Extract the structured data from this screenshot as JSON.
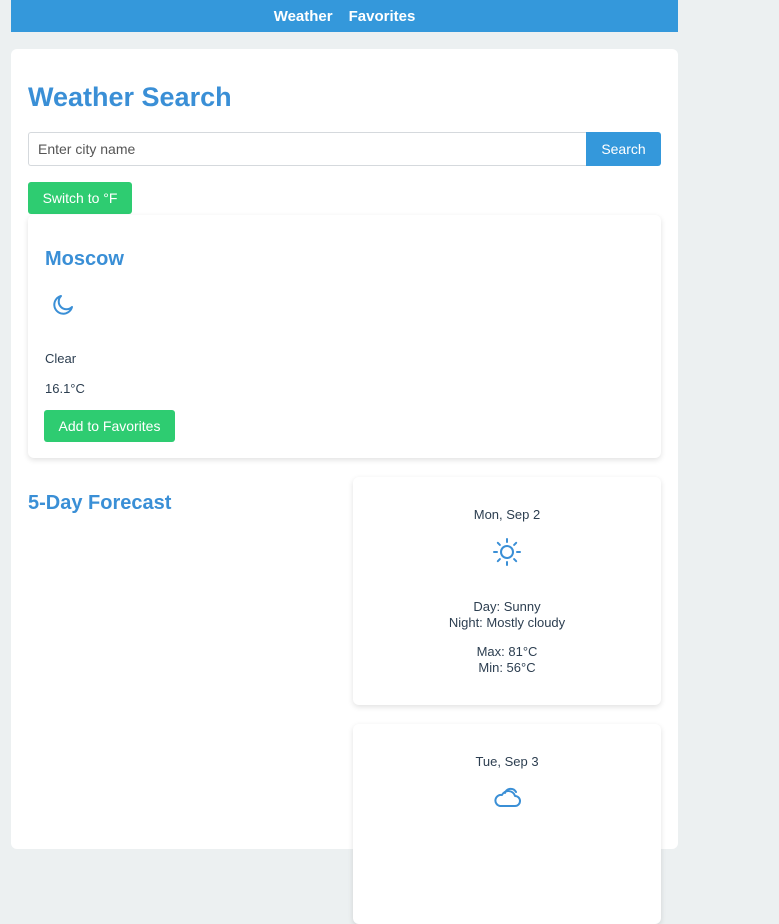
{
  "nav": {
    "weather_label": "Weather",
    "favorites_label": "Favorites"
  },
  "page": {
    "title": "Weather Search"
  },
  "search": {
    "placeholder": "Enter city name",
    "value": "",
    "button_label": "Search"
  },
  "unit_toggle": {
    "label": "Switch to °F"
  },
  "current": {
    "city": "Moscow",
    "icon": "moon-icon",
    "condition": "Clear",
    "temperature": "16.1°C",
    "favorite_button_label": "Add to Favorites"
  },
  "forecast": {
    "title": "5-Day Forecast",
    "days": [
      {
        "date": "Mon, Sep 2",
        "icon": "sun-icon",
        "day": "Day: Sunny",
        "night": "Night: Mostly cloudy",
        "max": "Max: 81°C",
        "min": "Min: 56°C"
      },
      {
        "date": "Tue, Sep 3",
        "icon": "cloud-icon"
      }
    ]
  },
  "colors": {
    "primary": "#3498db",
    "accent_green": "#2ecc71",
    "heading": "#3a8fd6",
    "background": "#ecf0f1"
  }
}
